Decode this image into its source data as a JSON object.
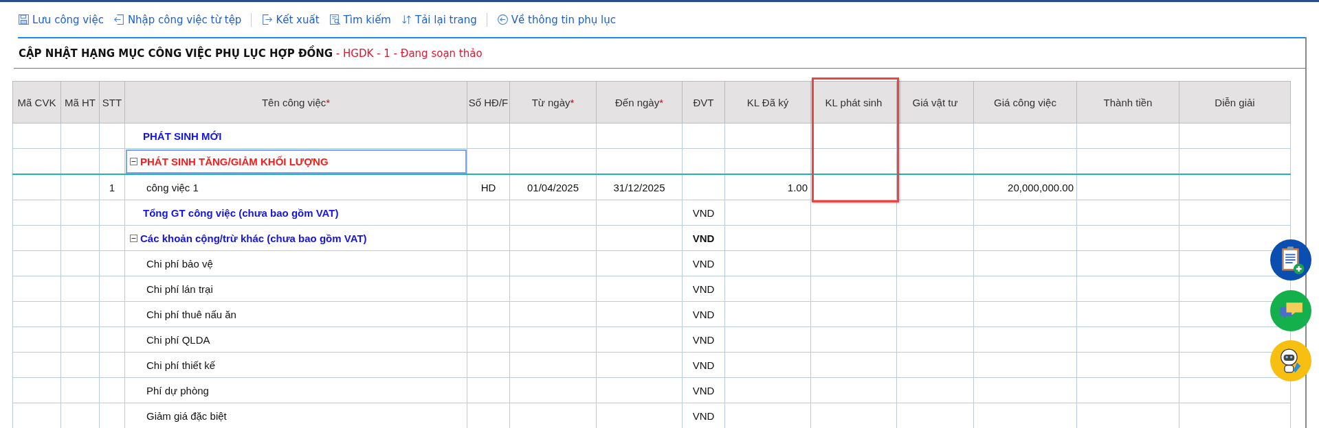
{
  "toolbar": [
    [
      {
        "label": "Lưu công việc"
      },
      {
        "label": "Nhập công việc từ tệp"
      }
    ],
    [
      {
        "label": "Kết xuất"
      },
      {
        "label": "Tìm kiếm"
      },
      {
        "label": "Tải lại trang"
      }
    ],
    [
      {
        "label": "Về thông tin phụ lục"
      }
    ]
  ],
  "title": {
    "main": "CẬP NHẬT HẠNG MỤC CÔNG VIỆC PHỤ LỤC HỢP ĐỒNG",
    "suffix": " - HGDK - 1 - Đang soạn thảo"
  },
  "table": {
    "columns": [
      {
        "label": "Mã CVK",
        "highlighted": false
      },
      {
        "label": "Mã HT",
        "highlighted": false
      },
      {
        "label": "STT",
        "highlighted": false
      },
      {
        "label": "Tên công việc",
        "required_mark": "*",
        "highlighted": false
      },
      {
        "label": "Số HĐ/F",
        "highlighted": false
      },
      {
        "label": "Từ ngày",
        "required_mark": "*",
        "highlighted": false
      },
      {
        "label": "Đến ngày",
        "required_mark": "*",
        "highlighted": false
      },
      {
        "label": "ĐVT",
        "highlighted": false
      },
      {
        "label": "KL Đã ký",
        "highlighted": false
      },
      {
        "label": "KL phát sinh",
        "highlighted": true
      },
      {
        "label": "Giá vật tư",
        "highlighted": false
      },
      {
        "label": "Giá công việc",
        "highlighted": false
      },
      {
        "label": "Thành tiền",
        "highlighted": false
      },
      {
        "label": "Diễn giải",
        "highlighted": false
      }
    ],
    "rows": [
      {
        "kind": "section",
        "selected": false,
        "name": "PHÁT SINH MỚI"
      },
      {
        "kind": "red-section",
        "expanded": true,
        "selected": true,
        "name": "PHÁT SINH TĂNG/GIẢM KHỐI LƯỢNG"
      },
      {
        "kind": "item",
        "selected": false,
        "stt": "1",
        "name": "công việc 1",
        "contract_no": "HD",
        "from_date": "01/04/2025",
        "to_date": "31/12/2025",
        "signed_qty": "1.00",
        "work_price": "20,000,000.00"
      },
      {
        "kind": "section",
        "selected": false,
        "name": "Tổng GT công việc (chưa bao gồm VAT)",
        "unit": "VND"
      },
      {
        "kind": "group",
        "expanded": true,
        "selected": false,
        "name": "Các khoản cộng/trừ khác (chưa bao gồm VAT)",
        "unit": "VND"
      },
      {
        "kind": "sub",
        "selected": false,
        "name": "Chi phí bảo vệ",
        "unit": "VND"
      },
      {
        "kind": "sub",
        "selected": false,
        "name": "Chi phí lán trại",
        "unit": "VND"
      },
      {
        "kind": "sub",
        "selected": false,
        "name": "Chi phí thuê nấu ăn",
        "unit": "VND"
      },
      {
        "kind": "sub",
        "selected": false,
        "name": "Chi phí QLDA",
        "unit": "VND"
      },
      {
        "kind": "sub",
        "selected": false,
        "name": "Chi phí thiết kế",
        "unit": "VND"
      },
      {
        "kind": "sub",
        "selected": false,
        "name": "Phí dự phòng",
        "unit": "VND"
      },
      {
        "kind": "sub",
        "selected": false,
        "name": "Giảm giá đặc biệt",
        "unit": "VND"
      }
    ]
  }
}
